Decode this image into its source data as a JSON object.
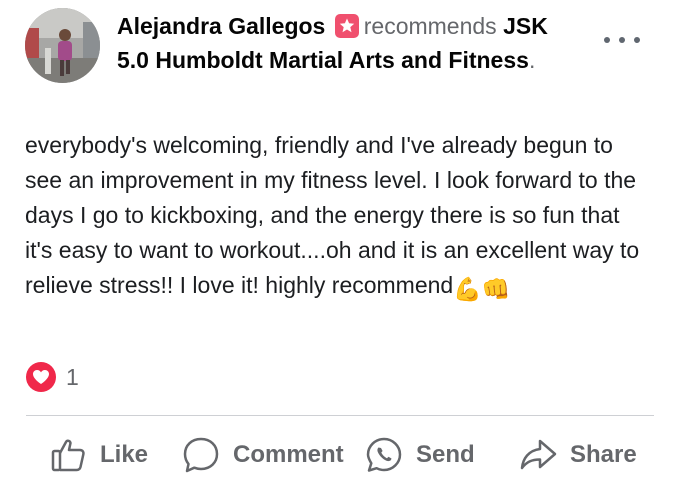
{
  "post": {
    "author": "Alejandra Gallegos",
    "verb": "recommends",
    "page_part1": "JSK",
    "page_part2": "5.0 Humboldt Martial Arts and Fitness",
    "end_punct": "."
  },
  "review": {
    "text": "everybody's welcoming, friendly and I've already begun to see an improvement in my fitness level. I look forward to the days I go to kickboxing, and the energy there is so fun that it's easy to want to workout....oh and it is an excellent way to relieve stress!! I love it! highly recommend",
    "emojis": [
      "💪",
      "👊"
    ]
  },
  "reactions": {
    "count": "1",
    "icon": "heart-icon",
    "color": "#f0284a"
  },
  "actions": {
    "like": "Like",
    "comment": "Comment",
    "send": "Send",
    "share": "Share"
  },
  "icons": {
    "recommend_badge": "star-badge-icon",
    "more": "more-options-icon"
  },
  "colors": {
    "recommend_badge": "#f0506e",
    "secondary_text": "#65676b"
  }
}
